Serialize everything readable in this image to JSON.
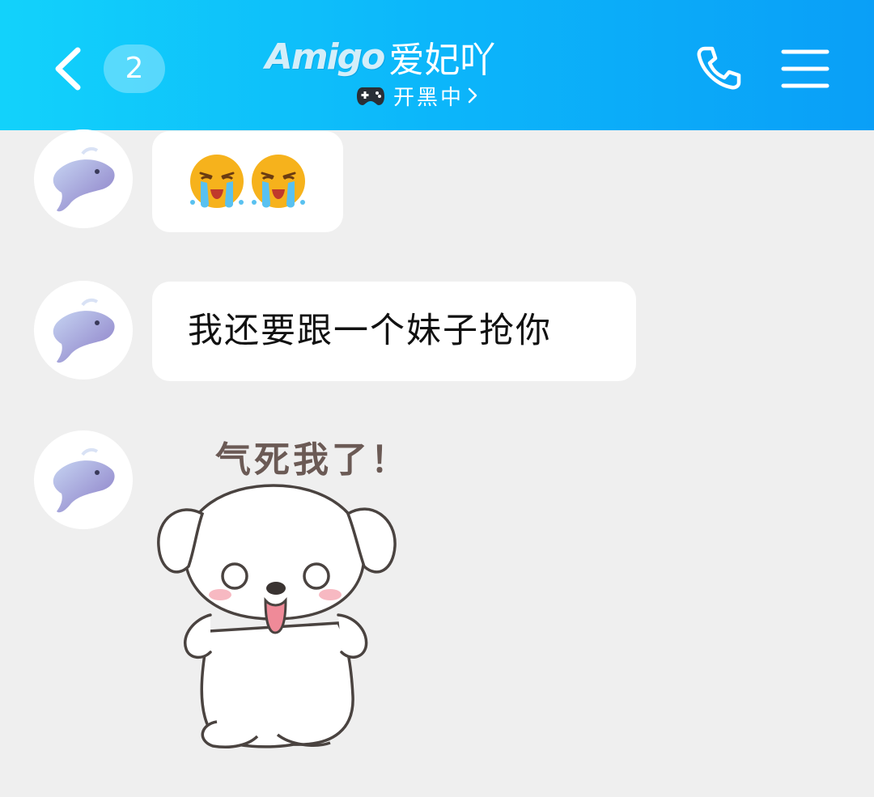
{
  "header": {
    "unread_count": "2",
    "title_brand": "Amigo",
    "title_name": "爱妃吖",
    "status_text": "开黑中",
    "icons": {
      "back": "chevron-left-icon",
      "status": "gamepad-icon",
      "status_more": "chevron-right-icon",
      "call": "phone-icon",
      "menu": "hamburger-menu-icon"
    }
  },
  "messages": [
    {
      "type": "emoji",
      "emojis": [
        "loudly-crying-face",
        "loudly-crying-face"
      ]
    },
    {
      "type": "text",
      "text": "我还要跟一个妹子抢你"
    },
    {
      "type": "sticker",
      "caption": "气死我了！",
      "sticker": "angry-white-puppy"
    }
  ],
  "colors": {
    "header_start": "#12d2fb",
    "header_end": "#0a9ff7",
    "background": "#efefef",
    "bubble": "#ffffff"
  }
}
